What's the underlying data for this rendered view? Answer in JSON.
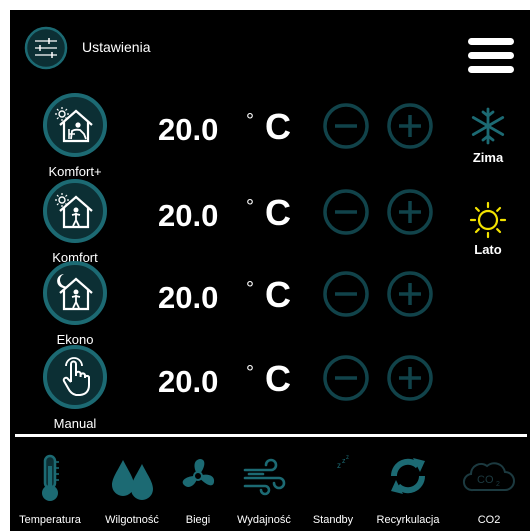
{
  "header": {
    "title": "Ustawienia",
    "settings_icon": "sliders-icon",
    "menu_icon": "hamburger-icon"
  },
  "colors": {
    "accent": "#11434a",
    "accent_light": "#1c6a73",
    "background": "#000000",
    "text": "#ffffff",
    "sun": "#f3e300",
    "snow": "#1c6a73"
  },
  "modes": [
    {
      "label": "Komfort+",
      "temperature": "20.0",
      "unit": "C",
      "icon": "comfort-plus-house-icon"
    },
    {
      "label": "Komfort",
      "temperature": "20.0",
      "unit": "C",
      "icon": "comfort-house-icon"
    },
    {
      "label": "Ekono",
      "temperature": "20.0",
      "unit": "C",
      "icon": "eco-house-moon-icon"
    },
    {
      "label": "Manual",
      "temperature": "20.0",
      "unit": "C",
      "icon": "hand-touch-icon"
    }
  ],
  "seasons": [
    {
      "label": "Zima",
      "icon": "snowflake-icon"
    },
    {
      "label": "Lato",
      "icon": "sun-icon"
    }
  ],
  "bottom_nav": [
    {
      "label": "Temperatura",
      "icon": "thermometer-icon"
    },
    {
      "label": "Wilgotność",
      "icon": "water-drops-icon"
    },
    {
      "label": "Biegi",
      "icon": "fan-icon"
    },
    {
      "label": "Wydajność",
      "icon": "wind-icon"
    },
    {
      "label": "Standby",
      "icon": "moon-sleep-icon"
    },
    {
      "label": "Recyrkulacja",
      "icon": "recirculation-icon"
    },
    {
      "label": "CO2",
      "icon": "co2-cloud-icon"
    }
  ]
}
